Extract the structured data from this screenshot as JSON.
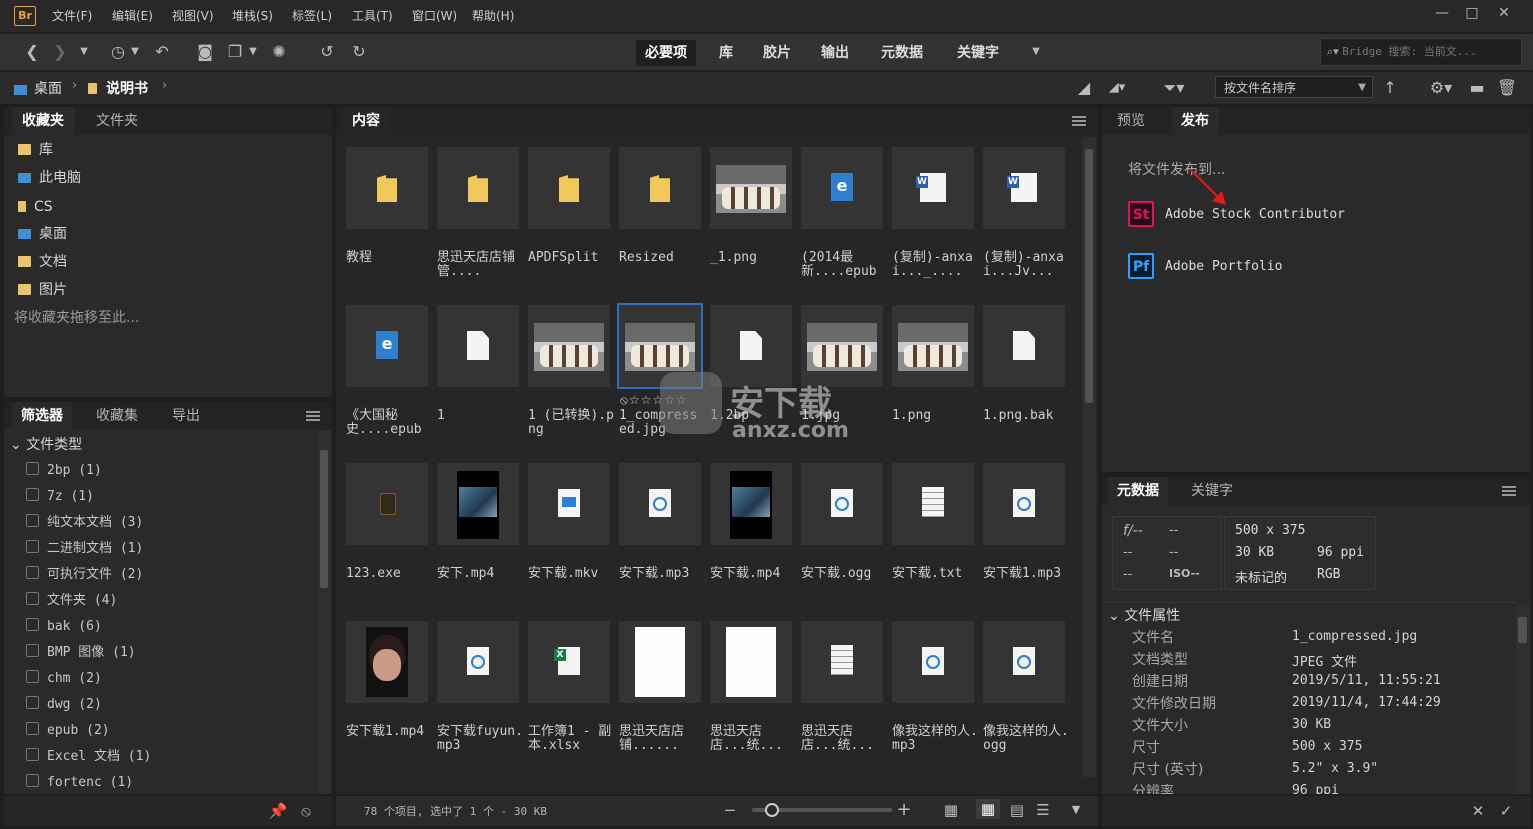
{
  "app": {
    "logo": "Br"
  },
  "menu": [
    "文件(F)",
    "编辑(E)",
    "视图(V)",
    "堆栈(S)",
    "标签(L)",
    "工具(T)",
    "窗口(W)",
    "帮助(H)"
  ],
  "window_controls": {
    "minimize": "—",
    "maximize": "□",
    "close": "✕"
  },
  "workspaces": [
    {
      "label": "必要项",
      "active": true
    },
    {
      "label": "库",
      "active": false
    },
    {
      "label": "胶片",
      "active": false
    },
    {
      "label": "输出",
      "active": false
    },
    {
      "label": "元数据",
      "active": false
    },
    {
      "label": "关键字",
      "active": false
    }
  ],
  "search": {
    "placeholder": "Bridge 搜索: 当前文..."
  },
  "breadcrumb": {
    "item1": "桌面",
    "item2": "说明书"
  },
  "sort": {
    "label": "按文件名排序"
  },
  "favorites_panel": {
    "tabs": [
      "收藏夹",
      "文件夹"
    ],
    "items": [
      "库",
      "此电脑",
      "CS",
      "桌面",
      "文档",
      "图片"
    ],
    "hint": "将收藏夹拖移至此..."
  },
  "filter_panel": {
    "tabs": [
      "筛选器",
      "收藏集",
      "导出"
    ],
    "section": "文件类型",
    "items": [
      "2bp  (1)",
      "7z  (1)",
      "纯文本文档  (3)",
      "二进制文档  (1)",
      "可执行文件  (2)",
      "文件夹  (4)",
      "bak  (6)",
      "BMP 图像  (1)",
      "chm  (2)",
      "dwg  (2)",
      "epub  (2)",
      "Excel 文档  (1)",
      "fortenc  (1)"
    ]
  },
  "content_panel": {
    "tab": "内容",
    "rows": [
      [
        {
          "label": "教程",
          "kind": "folder"
        },
        {
          "label": "思迅天店店铺管....",
          "kind": "folder"
        },
        {
          "label": "APDFSplit",
          "kind": "folder"
        },
        {
          "label": "Resized",
          "kind": "folder"
        },
        {
          "label": "_1.png",
          "kind": "dogs"
        },
        {
          "label": "(2014最新....epub",
          "kind": "epub"
        },
        {
          "label": "(复制)-anxai..._....",
          "kind": "word"
        },
        {
          "label": "(复制)-anxai...Jv...",
          "kind": "word"
        }
      ],
      [
        {
          "label": "《大国秘史....epub",
          "kind": "epub"
        },
        {
          "label": "1",
          "kind": "doc"
        },
        {
          "label": "1 (已转换).png",
          "kind": "dogs"
        },
        {
          "label": "1_compressed.jpg",
          "kind": "dogs",
          "selected": true
        },
        {
          "label": "1.2bp",
          "kind": "doc"
        },
        {
          "label": "1.jpg",
          "kind": "dogs"
        },
        {
          "label": "1.png",
          "kind": "dogs"
        },
        {
          "label": "1.png.bak",
          "kind": "doc"
        }
      ],
      [
        {
          "label": "123.exe",
          "kind": "exe"
        },
        {
          "label": "安下.mp4",
          "kind": "movie"
        },
        {
          "label": "安下载.mkv",
          "kind": "video"
        },
        {
          "label": "安下载.mp3",
          "kind": "audio"
        },
        {
          "label": "安下载.mp4",
          "kind": "movie"
        },
        {
          "label": "安下载.ogg",
          "kind": "audio"
        },
        {
          "label": "安下载.txt",
          "kind": "txt"
        },
        {
          "label": "安下载1.mp3",
          "kind": "audio"
        }
      ],
      [
        {
          "label": "安下载1.mp4",
          "kind": "person"
        },
        {
          "label": "安下载fuyun.mp3",
          "kind": "audio"
        },
        {
          "label": "工作簿1 - 副本.xlsx",
          "kind": "excel"
        },
        {
          "label": "思迅天店店铺......",
          "kind": "page"
        },
        {
          "label": "思迅天店店...统...",
          "kind": "page"
        },
        {
          "label": "思迅天店店...统...",
          "kind": "txt"
        },
        {
          "label": "像我这样的人.mp3",
          "kind": "audio"
        },
        {
          "label": "像我这样的人.ogg",
          "kind": "audio"
        }
      ]
    ],
    "selected_rating": "⦸☆☆☆☆☆"
  },
  "watermark": {
    "line1": "安下载",
    "line2": "anxz.com"
  },
  "status": {
    "text": "78 个项目, 选中了 1 个 - 30 KB",
    "zoom_level": 0.1
  },
  "publish_panel": {
    "tabs": [
      "预览",
      "发布"
    ],
    "heading": "将文件发布到...",
    "targets": [
      {
        "icon": "St",
        "label": "Adobe Stock Contributor",
        "color": "#e0115f"
      },
      {
        "icon": "Pf",
        "label": "Adobe Portfolio",
        "color": "#2fa0ff"
      }
    ]
  },
  "metadata_panel": {
    "tabs": [
      "元数据",
      "关键字"
    ],
    "camera": {
      "f": "f/--",
      "a": "--",
      "b": "--",
      "c": "--",
      "d": "--",
      "iso": "ISO--"
    },
    "info": {
      "dims": "500 x 375",
      "size": "30 KB",
      "ppi": "96 ppi",
      "tag": "未标记的",
      "mode": "RGB"
    },
    "section": "文件属性",
    "props": [
      {
        "k": "文件名",
        "v": "1_compressed.jpg"
      },
      {
        "k": "文档类型",
        "v": "JPEG 文件"
      },
      {
        "k": "创建日期",
        "v": "2019/5/11, 11:55:21"
      },
      {
        "k": "文件修改日期",
        "v": "2019/11/4, 17:44:29"
      },
      {
        "k": "文件大小",
        "v": "30 KB"
      },
      {
        "k": "尺寸",
        "v": "500 x 375"
      },
      {
        "k": "尺寸 (英寸)",
        "v": "5.2\" x 3.9\""
      },
      {
        "k": "分辨率",
        "v": "96 ppi"
      }
    ]
  },
  "colors": {
    "accent": "#2d6fc8",
    "arrow": "#e21b1b",
    "folder": "#f0c95a"
  }
}
